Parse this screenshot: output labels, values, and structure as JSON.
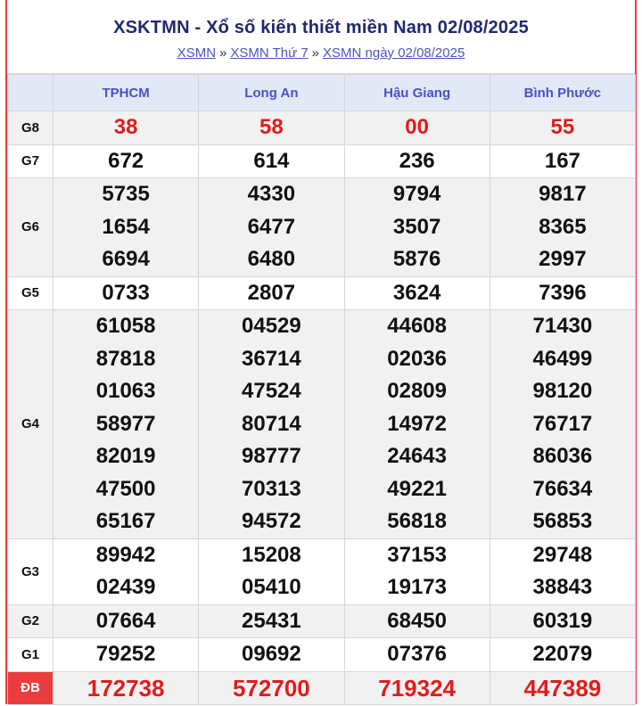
{
  "header": {
    "title": "XSKTMN - Xổ số kiến thiết miền Nam 02/08/2025",
    "breadcrumb": [
      "XSMN",
      "XSMN Thứ 7",
      "XSMN ngày 02/08/2025"
    ],
    "separator": "»"
  },
  "provinces": [
    "TPHCM",
    "Long An",
    "Hậu Giang",
    "Bình Phước"
  ],
  "prizes": [
    {
      "label": "G8",
      "numbers": [
        [
          "38"
        ],
        [
          "58"
        ],
        [
          "00"
        ],
        [
          "55"
        ]
      ]
    },
    {
      "label": "G7",
      "numbers": [
        [
          "672"
        ],
        [
          "614"
        ],
        [
          "236"
        ],
        [
          "167"
        ]
      ]
    },
    {
      "label": "G6",
      "numbers": [
        [
          "5735",
          "1654",
          "6694"
        ],
        [
          "4330",
          "6477",
          "6480"
        ],
        [
          "9794",
          "3507",
          "5876"
        ],
        [
          "9817",
          "8365",
          "2997"
        ]
      ]
    },
    {
      "label": "G5",
      "numbers": [
        [
          "0733"
        ],
        [
          "2807"
        ],
        [
          "3624"
        ],
        [
          "7396"
        ]
      ]
    },
    {
      "label": "G4",
      "numbers": [
        [
          "61058",
          "87818",
          "01063",
          "58977",
          "82019",
          "47500",
          "65167"
        ],
        [
          "04529",
          "36714",
          "47524",
          "80714",
          "98777",
          "70313",
          "94572"
        ],
        [
          "44608",
          "02036",
          "02809",
          "14972",
          "24643",
          "49221",
          "56818"
        ],
        [
          "71430",
          "46499",
          "98120",
          "76717",
          "86036",
          "76634",
          "56853"
        ]
      ]
    },
    {
      "label": "G3",
      "numbers": [
        [
          "89942",
          "02439"
        ],
        [
          "15208",
          "05410"
        ],
        [
          "37153",
          "19173"
        ],
        [
          "29748",
          "38843"
        ]
      ]
    },
    {
      "label": "G2",
      "numbers": [
        [
          "07664"
        ],
        [
          "25431"
        ],
        [
          "68450"
        ],
        [
          "60319"
        ]
      ]
    },
    {
      "label": "G1",
      "numbers": [
        [
          "79252"
        ],
        [
          "09692"
        ],
        [
          "07376"
        ],
        [
          "22079"
        ]
      ]
    },
    {
      "label": "ĐB",
      "numbers": [
        [
          "172738"
        ],
        [
          "572700"
        ],
        [
          "719324"
        ],
        [
          "447389"
        ]
      ]
    }
  ],
  "colors": {
    "accent_red": "#e01c1c",
    "header_blue": "#1e2a6e",
    "link_blue": "#4a56c0",
    "db_label_bg": "#ea3d3f"
  }
}
